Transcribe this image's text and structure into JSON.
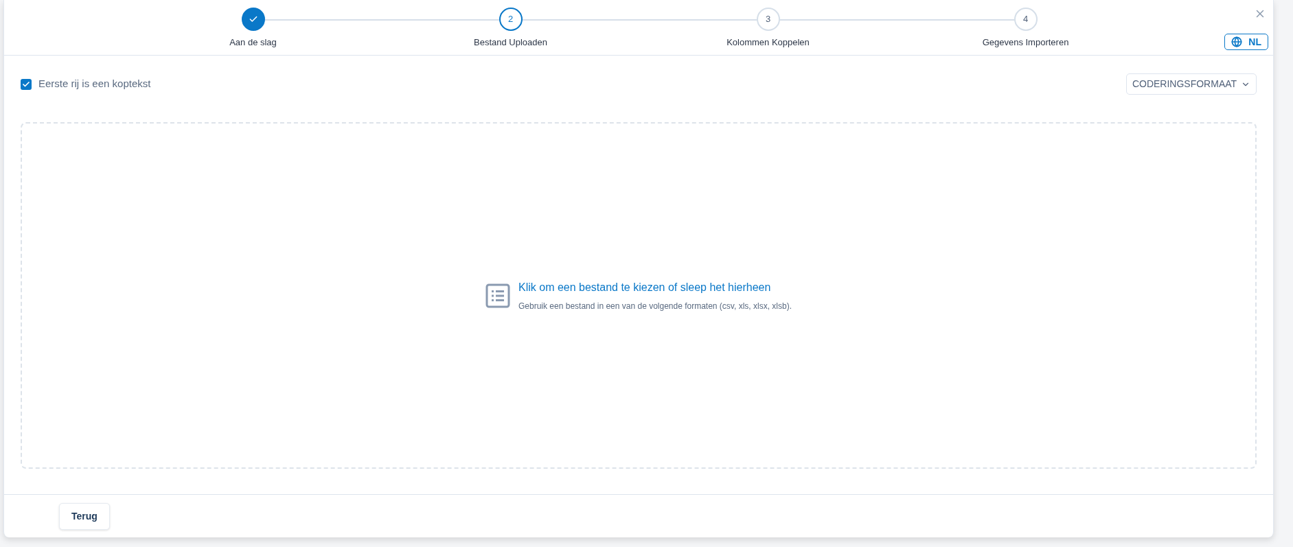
{
  "steps": [
    {
      "label": "Aan de slag",
      "completed": true,
      "selected": false
    },
    {
      "label": "Bestand Uploaden",
      "number": "2",
      "completed": false,
      "selected": true
    },
    {
      "label": "Kolommen Koppelen",
      "number": "3",
      "completed": false,
      "selected": false
    },
    {
      "label": "Gegevens Importeren",
      "number": "4",
      "completed": false,
      "selected": false
    }
  ],
  "language_button": "NL",
  "header_checkbox": {
    "label": "Eerste rij is een koptekst",
    "checked": true
  },
  "encoding_dropdown": "CODERINGSFORMAAT",
  "drop_zone": {
    "title": "Klik om een bestand te kiezen of sleep het hierheen",
    "hint": "Gebruik een bestand in een van de volgende formaten (csv, xls, xlsx, xlsb)."
  },
  "footer": {
    "back_button": "Terug"
  }
}
